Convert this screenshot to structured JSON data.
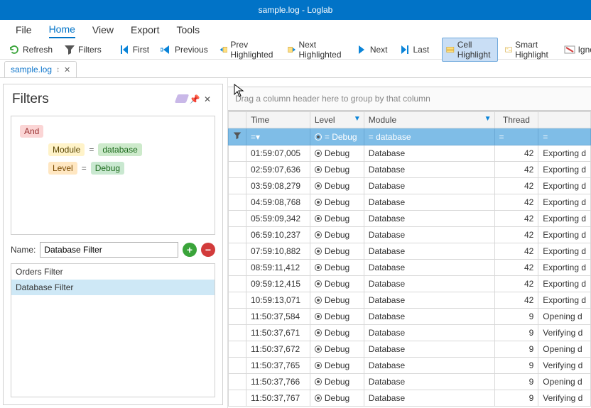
{
  "window": {
    "title": "sample.log - Loglab"
  },
  "menubar": [
    "File",
    "Home",
    "View",
    "Export",
    "Tools"
  ],
  "menubar_active": "Home",
  "toolbar": {
    "refresh": "Refresh",
    "filters": "Filters",
    "first": "First",
    "previous": "Previous",
    "prev_high": "Prev Highlighted",
    "next_high": "Next Highlighted",
    "next": "Next",
    "last": "Last",
    "cell_high": "Cell Highlight",
    "smart_high": "Smart Highlight",
    "ignore": "Ignore"
  },
  "tab": {
    "label": "sample.log"
  },
  "filters_panel": {
    "title": "Filters",
    "root": "And",
    "cond1_field": "Module",
    "cond1_val": "database",
    "cond2_field": "Level",
    "cond2_val": "Debug",
    "name_label": "Name:",
    "name_value": "Database Filter",
    "list": [
      "Orders Filter",
      "Database Filter"
    ],
    "selected": "Database Filter"
  },
  "grid": {
    "group_hint": "Drag a column header here to group by that column",
    "headers": {
      "time": "Time",
      "level": "Level",
      "module": "Module",
      "thread": "Thread"
    },
    "filter_row": {
      "time": "=",
      "level": "=  Debug",
      "module": "=  database",
      "thread": "=",
      "msg": "="
    },
    "rows": [
      {
        "time": "01:59:07,005",
        "level": "Debug",
        "module": "Database",
        "thread": "42",
        "msg": "Exporting d"
      },
      {
        "time": "02:59:07,636",
        "level": "Debug",
        "module": "Database",
        "thread": "42",
        "msg": "Exporting d"
      },
      {
        "time": "03:59:08,279",
        "level": "Debug",
        "module": "Database",
        "thread": "42",
        "msg": "Exporting d"
      },
      {
        "time": "04:59:08,768",
        "level": "Debug",
        "module": "Database",
        "thread": "42",
        "msg": "Exporting d"
      },
      {
        "time": "05:59:09,342",
        "level": "Debug",
        "module": "Database",
        "thread": "42",
        "msg": "Exporting d"
      },
      {
        "time": "06:59:10,237",
        "level": "Debug",
        "module": "Database",
        "thread": "42",
        "msg": "Exporting d"
      },
      {
        "time": "07:59:10,882",
        "level": "Debug",
        "module": "Database",
        "thread": "42",
        "msg": "Exporting d"
      },
      {
        "time": "08:59:11,412",
        "level": "Debug",
        "module": "Database",
        "thread": "42",
        "msg": "Exporting d"
      },
      {
        "time": "09:59:12,415",
        "level": "Debug",
        "module": "Database",
        "thread": "42",
        "msg": "Exporting d"
      },
      {
        "time": "10:59:13,071",
        "level": "Debug",
        "module": "Database",
        "thread": "42",
        "msg": "Exporting d"
      },
      {
        "time": "11:50:37,584",
        "level": "Debug",
        "module": "Database",
        "thread": "9",
        "msg": "Opening d"
      },
      {
        "time": "11:50:37,671",
        "level": "Debug",
        "module": "Database",
        "thread": "9",
        "msg": "Verifying d"
      },
      {
        "time": "11:50:37,672",
        "level": "Debug",
        "module": "Database",
        "thread": "9",
        "msg": "Opening d"
      },
      {
        "time": "11:50:37,765",
        "level": "Debug",
        "module": "Database",
        "thread": "9",
        "msg": "Verifying d"
      },
      {
        "time": "11:50:37,766",
        "level": "Debug",
        "module": "Database",
        "thread": "9",
        "msg": "Opening d"
      },
      {
        "time": "11:50:37,767",
        "level": "Debug",
        "module": "Database",
        "thread": "9",
        "msg": "Verifying d"
      }
    ]
  }
}
